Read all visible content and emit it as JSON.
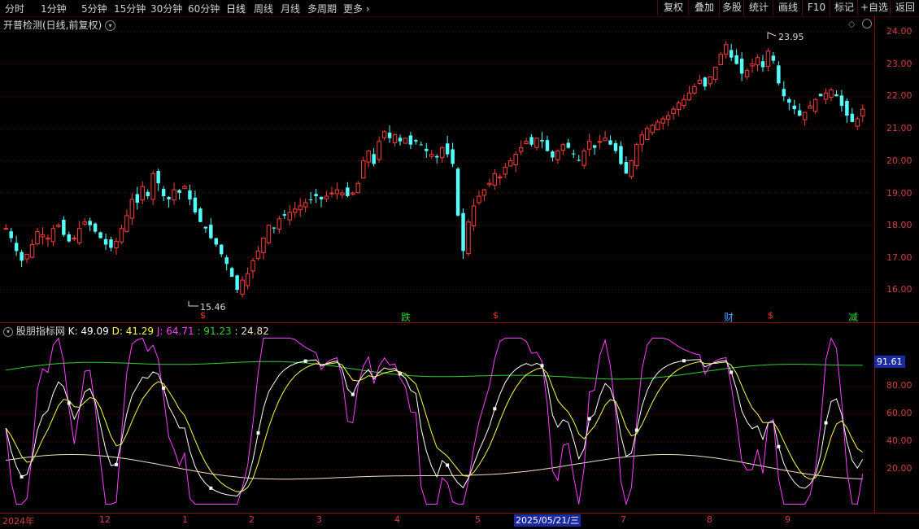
{
  "toolbar": {
    "periods": [
      "分时",
      "1分钟",
      "5分钟",
      "15分钟",
      "30分钟",
      "60分钟",
      "日线",
      "周线",
      "月线",
      "多周期",
      "更多"
    ],
    "active_period": "日线",
    "more_icon": "chevron-right-icon",
    "right_buttons": [
      "复权",
      "叠加",
      "多股",
      "统计",
      "画线",
      "F10",
      "标记",
      "+自选",
      "返回"
    ]
  },
  "main_panel": {
    "title": "开普检测(日线,前复权)",
    "dropdown_icon": "chevron-down-circle-icon",
    "y_ticks": [
      "24.00",
      "23.00",
      "22.00",
      "21.00",
      "20.00",
      "19.00",
      "18.00",
      "17.00",
      "16.00"
    ],
    "high_label": "23.95",
    "low_label": "15.46",
    "event_markers": [
      {
        "text": "$",
        "color": "#ff3030"
      },
      {
        "text": "跌",
        "color": "#30d030"
      },
      {
        "text": "$",
        "color": "#ff3030"
      },
      {
        "text": "财",
        "color": "#40a0ff"
      },
      {
        "text": "$",
        "color": "#ff3030"
      },
      {
        "text": "减",
        "color": "#30d030"
      }
    ]
  },
  "indicator_panel": {
    "name": "股朋指标网",
    "k_label": "K: 49.09",
    "d_label": "D: 41.29",
    "j_label": "J: 64.71",
    "l4_label": ": 91.23",
    "l5_label": ": 24.82",
    "y_ticks": [
      "80.00",
      "60.00",
      "40.00",
      "20.00"
    ],
    "current_tag": "91.61"
  },
  "x_axis": {
    "labels": [
      "2024年",
      "12",
      "1",
      "2",
      "3",
      "4",
      "5",
      "2025/05/21/三",
      "7",
      "8",
      "9"
    ]
  },
  "colors": {
    "up": "#ff3c3c",
    "down": "#54ffff",
    "k_line": "#ffffff",
    "d_line": "#ffff40",
    "j_line": "#ff40ff",
    "upper_band": "#30d030",
    "lower_band": "#f0e0c0",
    "axis": "#8a1010"
  },
  "chart_data": {
    "type": "candlestick",
    "price_range": [
      15.2,
      24.4
    ],
    "closes": [
      17.9,
      17.6,
      17.2,
      16.9,
      17.1,
      17.4,
      17.8,
      17.7,
      17.6,
      17.9,
      18.0,
      17.7,
      17.5,
      17.6,
      17.9,
      18.1,
      18.0,
      17.8,
      17.6,
      17.4,
      17.3,
      17.5,
      17.9,
      18.3,
      18.8,
      18.7,
      19.2,
      18.9,
      19.6,
      19.3,
      18.9,
      18.8,
      19.1,
      19.0,
      19.2,
      18.8,
      18.4,
      18.1,
      17.9,
      17.6,
      17.4,
      17.1,
      16.8,
      16.4,
      16.0,
      16.3,
      16.5,
      16.9,
      17.2,
      17.6,
      18.0,
      17.9,
      18.2,
      18.3,
      18.4,
      18.5,
      18.6,
      18.7,
      18.8,
      18.9,
      18.8,
      18.9,
      19.0,
      19.1,
      19.0,
      18.9,
      19.0,
      19.3,
      20.0,
      20.3,
      19.9,
      20.6,
      20.9,
      20.7,
      20.8,
      20.6,
      20.7,
      20.5,
      20.6,
      20.5,
      20.3,
      20.2,
      20.1,
      20.4,
      20.2,
      19.9,
      18.3,
      17.2,
      18.1,
      18.6,
      18.9,
      19.1,
      19.3,
      19.6,
      19.5,
      19.8,
      20.0,
      20.2,
      20.4,
      20.6,
      20.5,
      20.7,
      20.6,
      20.3,
      20.1,
      20.3,
      20.5,
      20.4,
      20.2,
      20.0,
      20.3,
      20.6,
      20.4,
      20.6,
      20.7,
      20.5,
      20.3,
      19.9,
      19.6,
      20.0,
      20.5,
      20.8,
      21.0,
      21.1,
      21.2,
      21.3,
      21.4,
      21.6,
      21.8,
      21.9,
      22.1,
      22.3,
      22.5,
      22.3,
      22.6,
      22.9,
      23.3,
      23.6,
      23.2,
      23.0,
      22.7,
      22.8,
      23.0,
      23.2,
      22.9,
      23.4,
      23.1,
      22.4,
      22.0,
      21.8,
      21.6,
      21.4,
      21.5,
      21.7,
      21.9,
      22.0,
      22.1,
      22.2,
      22.0,
      21.7,
      21.4,
      21.2,
      21.3,
      21.6
    ]
  }
}
